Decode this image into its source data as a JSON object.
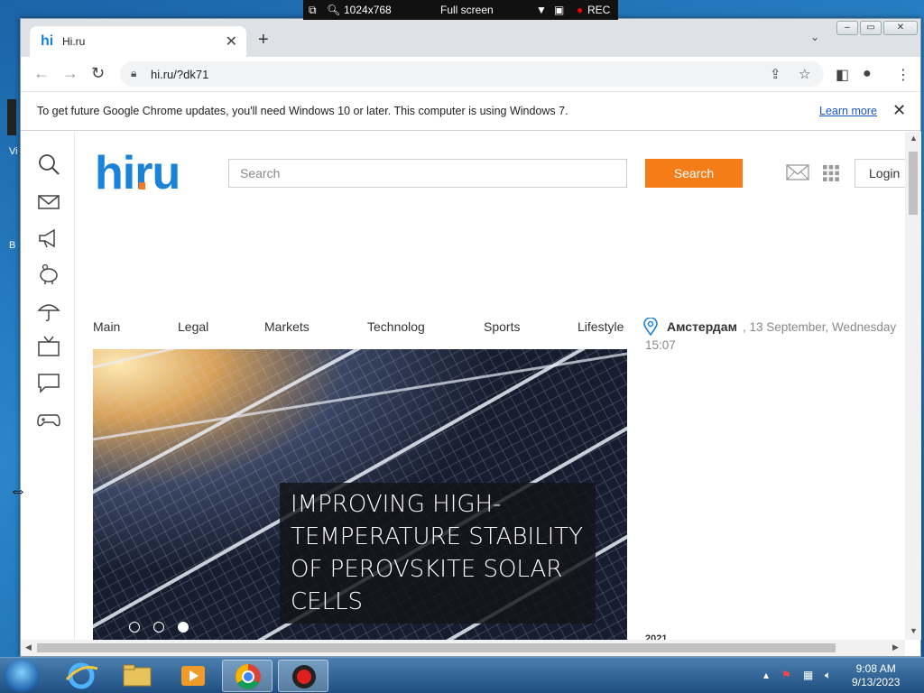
{
  "recording_bar": {
    "resolution": "1024x768",
    "mode": "Full screen",
    "rec_label": "REC"
  },
  "desktop": {
    "icon_fragment_1": "Vi",
    "icon_fragment_2": "B"
  },
  "browser": {
    "tab_title": "Hi.ru",
    "tab_favicon": "hi",
    "url": "hi.ru/?dk71",
    "infobar_message": "To get future Google Chrome updates, you'll need Windows 10 or later. This computer is using Windows 7.",
    "infobar_link": "Learn more"
  },
  "site": {
    "logo_main": "hi",
    "logo_dot": ".",
    "logo_tld": "ru",
    "search_placeholder": "Search",
    "search_button": "Search",
    "login": "Login",
    "nav": [
      "Main",
      "Legal",
      "Markets",
      "Technolog",
      "Sports",
      "Lifestyle"
    ],
    "location": "Амстердам",
    "date": ", 13 September, Wednesday",
    "time": "15:07",
    "headline": "IMPROVING HIGH-TEMPERATURE STABILITY OF PEROVSKITE SOLAR CELLS",
    "bottom_fragment": "2021",
    "slide_count": 3,
    "active_slide": 3
  },
  "taskbar": {
    "time": "9:08 AM",
    "date": "9/13/2023"
  },
  "colors": {
    "brand_blue": "#1a82d8",
    "brand_orange": "#f47b20",
    "search_button": "#f57c17"
  }
}
